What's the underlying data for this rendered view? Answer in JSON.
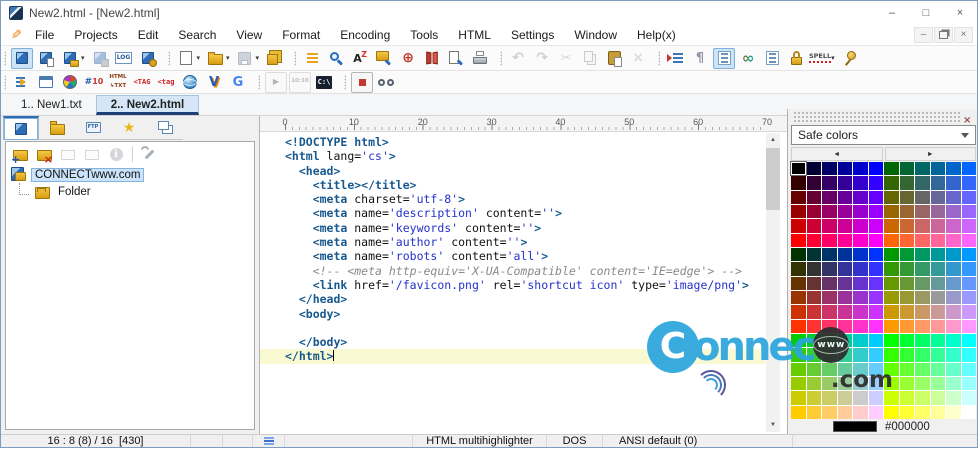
{
  "window": {
    "title": "New2.html - [New2.html]"
  },
  "controls": {
    "minimize": "–",
    "maximize": "□",
    "close": "×"
  },
  "mdi": {
    "minimize": "–",
    "close": "×"
  },
  "menu": [
    "File",
    "Projects",
    "Edit",
    "Search",
    "View",
    "Format",
    "Encoding",
    "Tools",
    "HTML",
    "Settings",
    "Window",
    "Help(x)"
  ],
  "toolbar1": [
    [
      {
        "n": "project-activate",
        "s": "cube",
        "active": true
      },
      {
        "n": "project-add-file",
        "s": "cube-page"
      },
      {
        "n": "project-open",
        "s": "cube-folder",
        "caret": true
      },
      {
        "n": "project-save",
        "s": "cube-save",
        "d": true
      },
      {
        "n": "project-log",
        "s": "log"
      },
      {
        "n": "project-settings",
        "s": "cube-gear"
      }
    ],
    [
      {
        "n": "new-file",
        "s": "page",
        "caret": true
      },
      {
        "n": "open-file",
        "s": "folder",
        "caret": true
      },
      {
        "n": "save-file",
        "s": "floppy",
        "d": true,
        "caret": true
      },
      {
        "n": "save-all",
        "s": "floppy-multi"
      }
    ],
    [
      {
        "n": "reformat",
        "s": "reformat"
      },
      {
        "n": "find",
        "s": "mag"
      },
      {
        "n": "replace",
        "s": "az"
      },
      {
        "n": "find-in-files",
        "s": "folder-mag"
      },
      {
        "n": "goto-line",
        "s": "target"
      },
      {
        "n": "bookmarks",
        "s": "book"
      },
      {
        "n": "print-preview",
        "s": "page-mag"
      },
      {
        "n": "print",
        "s": "printer"
      }
    ],
    [
      {
        "n": "undo",
        "s": "undo",
        "d": true
      },
      {
        "n": "redo",
        "s": "redo",
        "d": true
      },
      {
        "n": "cut",
        "s": "scissors",
        "d": true
      },
      {
        "n": "copy",
        "s": "copy",
        "d": true
      },
      {
        "n": "paste",
        "s": "paste"
      },
      {
        "n": "delete",
        "s": "xmark",
        "d": true
      }
    ],
    [
      {
        "n": "insert-into-lines",
        "s": "indent"
      },
      {
        "n": "show-formatting",
        "s": "pilcrow"
      },
      {
        "n": "line-numbers",
        "s": "listbox",
        "active": true
      },
      {
        "n": "word-wrap",
        "s": "infinity"
      },
      {
        "n": "special-chars",
        "s": "listbox2"
      },
      {
        "n": "read-only-lock",
        "s": "lock"
      },
      {
        "n": "spell-check",
        "s": "spell",
        "caret": true
      },
      {
        "n": "stay-on-top-pin",
        "s": "pin"
      }
    ]
  ],
  "toolbar2": [
    [
      {
        "n": "html-reformat",
        "s": "taglines"
      },
      {
        "n": "tag-editor-window",
        "s": "window"
      },
      {
        "n": "color-wheel",
        "s": "colorwheel"
      },
      {
        "n": "color-code",
        "s": "hashten"
      },
      {
        "n": "html-to-text",
        "s": "htmltxt"
      },
      {
        "n": "strip-tags",
        "s": "tagu"
      },
      {
        "n": "lowercase-tags",
        "s": "tagl"
      },
      {
        "n": "open-in-browser-globe",
        "s": "globe"
      },
      {
        "n": "html-validator",
        "s": "vee"
      },
      {
        "n": "google-search",
        "s": "gee"
      }
    ],
    [
      {
        "n": "run-script",
        "s": "play",
        "d": true
      },
      {
        "n": "insert-datetime",
        "s": "tenten",
        "d": true
      },
      {
        "n": "dos-console",
        "s": "console"
      }
    ],
    [
      {
        "n": "record-macro",
        "s": "record"
      },
      {
        "n": "text-preview-glasses",
        "s": "glasses"
      }
    ]
  ],
  "doc_tabs": [
    {
      "label": "1.. New1.txt",
      "active": false
    },
    {
      "label": "2.. New2.html",
      "active": true
    }
  ],
  "left_panel": {
    "subtabs": [
      {
        "n": "project-tab",
        "s": "cube",
        "active": true
      },
      {
        "n": "files-tab",
        "s": "folder"
      },
      {
        "n": "ftp-tab",
        "s": "monitor-ftp"
      },
      {
        "n": "favorites-tab",
        "s": "star"
      },
      {
        "n": "open-windows-tab",
        "s": "winstack"
      }
    ],
    "tools": [
      {
        "n": "project-add-folder",
        "s": "folder-plus"
      },
      {
        "n": "project-remove",
        "s": "folder-x"
      },
      {
        "n": "project-folder-a",
        "s": "folder-gray",
        "d": true
      },
      {
        "n": "project-folder-b",
        "s": "folder-gray",
        "d": true
      },
      {
        "n": "project-info",
        "s": "info",
        "d": true
      },
      {
        "sep": true
      },
      {
        "n": "project-tools-wrench",
        "s": "wrench"
      }
    ],
    "tree": {
      "root": "CONNECTwww.com",
      "child": "Folder"
    }
  },
  "ruler": {
    "marks": [
      "0",
      "10",
      "20",
      "30",
      "40",
      "50",
      "60",
      "70"
    ]
  },
  "editor": {
    "cursor_line": 16,
    "lines": [
      [
        [
          "tag",
          "<!DOCTYPE html>"
        ]
      ],
      [
        [
          "tag",
          "<html"
        ],
        [
          "attr",
          " lang="
        ],
        [
          "val",
          "'cs'"
        ],
        [
          "tag",
          ">"
        ]
      ],
      [
        [
          "txt",
          "  "
        ],
        [
          "tag",
          "<head>"
        ]
      ],
      [
        [
          "txt",
          "    "
        ],
        [
          "tag",
          "<title></title>"
        ]
      ],
      [
        [
          "txt",
          "    "
        ],
        [
          "tag",
          "<meta"
        ],
        [
          "attr",
          " charset="
        ],
        [
          "val",
          "'utf-8'"
        ],
        [
          "tag",
          ">"
        ]
      ],
      [
        [
          "txt",
          "    "
        ],
        [
          "tag",
          "<meta"
        ],
        [
          "attr",
          " name="
        ],
        [
          "val",
          "'description'"
        ],
        [
          "attr",
          " content="
        ],
        [
          "val",
          "''"
        ],
        [
          "tag",
          ">"
        ]
      ],
      [
        [
          "txt",
          "    "
        ],
        [
          "tag",
          "<meta"
        ],
        [
          "attr",
          " name="
        ],
        [
          "val",
          "'keywords'"
        ],
        [
          "attr",
          " content="
        ],
        [
          "val",
          "''"
        ],
        [
          "tag",
          ">"
        ]
      ],
      [
        [
          "txt",
          "    "
        ],
        [
          "tag",
          "<meta"
        ],
        [
          "attr",
          " name="
        ],
        [
          "val",
          "'author'"
        ],
        [
          "attr",
          " content="
        ],
        [
          "val",
          "''"
        ],
        [
          "tag",
          ">"
        ]
      ],
      [
        [
          "txt",
          "    "
        ],
        [
          "tag",
          "<meta"
        ],
        [
          "attr",
          " name="
        ],
        [
          "val",
          "'robots'"
        ],
        [
          "attr",
          " content="
        ],
        [
          "val",
          "'all'"
        ],
        [
          "tag",
          ">"
        ]
      ],
      [
        [
          "txt",
          "    "
        ],
        [
          "com",
          "<!-- <meta http-equiv='X-UA-Compatible' content='IE=edge'> -->"
        ]
      ],
      [
        [
          "txt",
          "    "
        ],
        [
          "tag",
          "<link"
        ],
        [
          "attr",
          " href="
        ],
        [
          "val",
          "'/favicon.png'"
        ],
        [
          "attr",
          " rel="
        ],
        [
          "val",
          "'shortcut icon'"
        ],
        [
          "attr",
          " type="
        ],
        [
          "val",
          "'image/png'"
        ],
        [
          "tag",
          ">"
        ]
      ],
      [
        [
          "txt",
          "  "
        ],
        [
          "tag",
          "</head>"
        ]
      ],
      [
        [
          "txt",
          "  "
        ],
        [
          "tag",
          "<body>"
        ]
      ],
      [],
      [
        [
          "txt",
          "  "
        ],
        [
          "tag",
          "</body>"
        ]
      ],
      [
        [
          "tag",
          "</html>"
        ]
      ]
    ]
  },
  "color_panel": {
    "name": "Safe colors",
    "selected_hex": "#000000",
    "left_arrow": "◄",
    "right_arrow": "►",
    "levels": [
      "00",
      "33",
      "66",
      "99",
      "CC",
      "FF"
    ],
    "green_pairs": [
      [
        "00",
        "66"
      ],
      [
        "33",
        "99"
      ],
      [
        "CC",
        "FF"
      ]
    ]
  },
  "status_cells": [
    {
      "name": "caret-position",
      "text": "16 : 8 (8) / 16  [430]"
    },
    {
      "name": "status-empty-1",
      "text": ""
    },
    {
      "name": "status-empty-2",
      "text": ""
    },
    {
      "name": "modified-indicator",
      "icon": "list-lines",
      "text": ""
    },
    {
      "name": "status-empty-3",
      "text": ""
    },
    {
      "name": "syntax-highlighter",
      "text": "HTML multihighlighter"
    },
    {
      "name": "line-ending",
      "text": "DOS"
    },
    {
      "name": "encoding",
      "text": "ANSI default (0)"
    },
    {
      "name": "status-empty-4",
      "text": ""
    }
  ],
  "watermark": {
    "c": "C",
    "onnect": "onnect",
    "www": "www",
    "com": ".com"
  },
  "colors": {
    "accent_blue": "#2ca5dd",
    "active_line_bg": "#fafad2",
    "selection_bg": "#cbe4fb",
    "tab_underline": "#1f3f77"
  }
}
